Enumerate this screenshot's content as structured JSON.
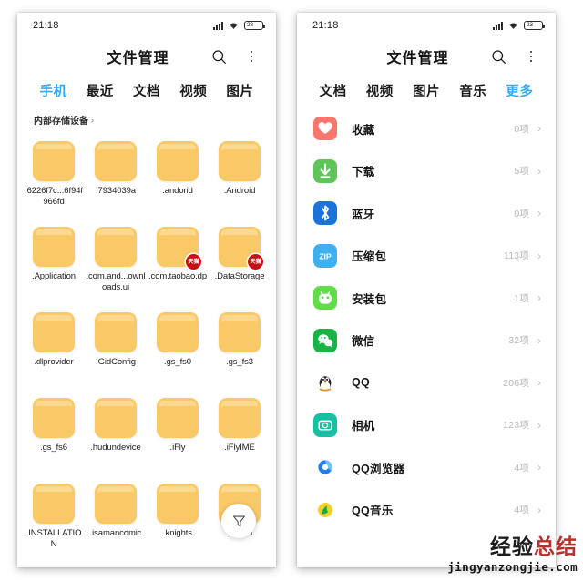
{
  "statusbar": {
    "time": "21:18",
    "battery_level": "23",
    "icons": [
      "signal-icon",
      "wifi-icon",
      "battery-icon"
    ]
  },
  "appbar": {
    "title": "文件管理",
    "search_icon": "search-icon",
    "overflow_icon": "more-vertical-icon"
  },
  "left_panel": {
    "tabs": [
      {
        "label": "手机",
        "active": true
      },
      {
        "label": "最近",
        "active": false
      },
      {
        "label": "文档",
        "active": false
      },
      {
        "label": "视频",
        "active": false
      },
      {
        "label": "图片",
        "active": false
      }
    ],
    "breadcrumb": {
      "label": "内部存储设备",
      "chevron": "›"
    },
    "files": [
      {
        "name": ".6226f7c...6f94f966fd",
        "badge": ""
      },
      {
        "name": ".7934039a",
        "badge": ""
      },
      {
        "name": ".andorid",
        "badge": ""
      },
      {
        "name": ".Android",
        "badge": ""
      },
      {
        "name": ".Application",
        "badge": ""
      },
      {
        "name": ".com.and...ownloads.ui",
        "badge": ""
      },
      {
        "name": ".com.taobao.dp",
        "badge": "天猫"
      },
      {
        "name": ".DataStorage",
        "badge": "天猫"
      },
      {
        "name": ".dlprovider",
        "badge": ""
      },
      {
        "name": ".GidConfig",
        "badge": ""
      },
      {
        "name": ".gs_fs0",
        "badge": ""
      },
      {
        "name": ".gs_fs3",
        "badge": ""
      },
      {
        "name": ".gs_fs6",
        "badge": ""
      },
      {
        "name": ".hudundevice",
        "badge": ""
      },
      {
        "name": ".iFly",
        "badge": ""
      },
      {
        "name": ".iFlyIME",
        "badge": ""
      },
      {
        "name": ".INSTALLATION",
        "badge": ""
      },
      {
        "name": ".isamancomic",
        "badge": ""
      },
      {
        "name": ".knights",
        "badge": ""
      },
      {
        "name": ".m...ua",
        "badge": ""
      }
    ],
    "fab": {
      "icon": "filter-funnel-icon"
    }
  },
  "right_panel": {
    "tabs": [
      {
        "label": "文档",
        "active": false
      },
      {
        "label": "视频",
        "active": false
      },
      {
        "label": "图片",
        "active": false
      },
      {
        "label": "音乐",
        "active": false
      },
      {
        "label": "更多",
        "active": true
      }
    ],
    "rows": [
      {
        "label": "收藏",
        "count": "0项",
        "icon": "favorites-heart-icon",
        "color": "#F9766E"
      },
      {
        "label": "下载",
        "count": "5项",
        "icon": "download-arrow-icon",
        "color": "#5FC55A"
      },
      {
        "label": "蓝牙",
        "count": "0项",
        "icon": "bluetooth-icon",
        "color": "#1A73D8"
      },
      {
        "label": "压缩包",
        "count": "113项",
        "icon": "zip-archive-icon",
        "color": "#3EB0F0"
      },
      {
        "label": "安装包",
        "count": "1项",
        "icon": "android-apk-icon",
        "color": "#62DD4A"
      },
      {
        "label": "微信",
        "count": "32项",
        "icon": "wechat-icon",
        "color": "#18B445"
      },
      {
        "label": "QQ",
        "count": "206项",
        "icon": "qq-penguin-icon",
        "color": "#FFFFFF"
      },
      {
        "label": "相机",
        "count": "123项",
        "icon": "camera-photo-icon",
        "color": "#17BFA3"
      },
      {
        "label": "QQ浏览器",
        "count": "4项",
        "icon": "qq-browser-icon",
        "color": "#FFFFFF"
      },
      {
        "label": "QQ音乐",
        "count": "4项",
        "icon": "qq-music-icon",
        "color": "#FFFFFF"
      }
    ],
    "chevron": "›"
  },
  "watermark": {
    "cn_dark": "经验",
    "cn_red": "总结",
    "en": "jingyanzongjie.com"
  }
}
